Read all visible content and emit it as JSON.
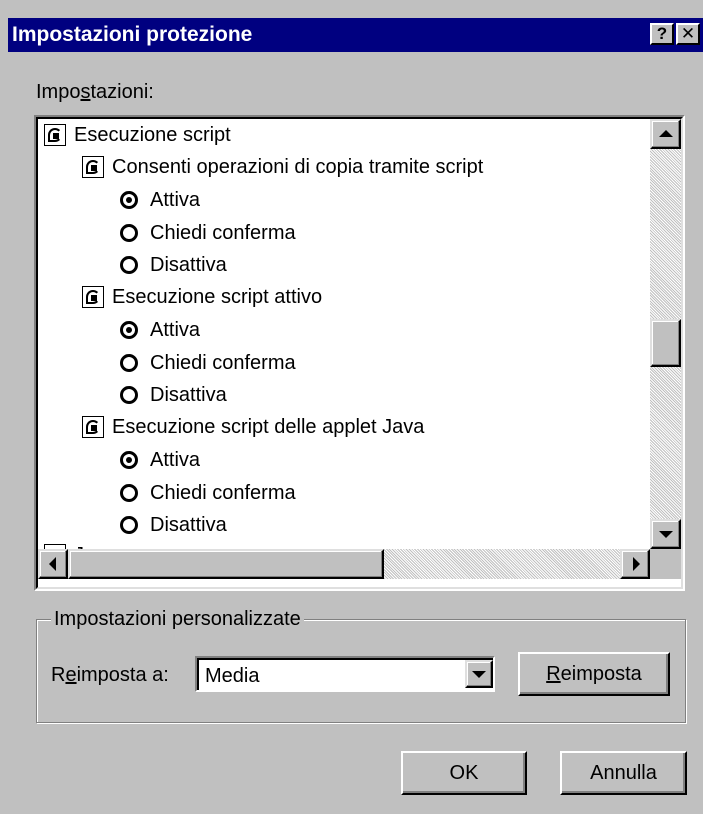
{
  "window": {
    "title": "Impostazioni protezione",
    "help_glyph": "?",
    "close_glyph": "✕"
  },
  "settings_label": {
    "pre": "Impo",
    "mnemonic": "s",
    "post": "tazioni:"
  },
  "tree": {
    "category": "Esecuzione script",
    "groups": [
      {
        "label": "Consenti operazioni di copia tramite script",
        "options": [
          {
            "label": "Attiva",
            "checked": true
          },
          {
            "label": "Chiedi conferma",
            "checked": false
          },
          {
            "label": "Disattiva",
            "checked": false
          }
        ]
      },
      {
        "label": "Esecuzione script attivo",
        "options": [
          {
            "label": "Attiva",
            "checked": true
          },
          {
            "label": "Chiedi conferma",
            "checked": false
          },
          {
            "label": "Disattiva",
            "checked": false
          }
        ]
      },
      {
        "label": "Esecuzione script delle applet Java",
        "options": [
          {
            "label": "Attiva",
            "checked": true
          },
          {
            "label": "Chiedi conferma",
            "checked": false
          },
          {
            "label": "Disattiva",
            "checked": false
          }
        ]
      }
    ],
    "next_category": "Java"
  },
  "custom_settings": {
    "legend": "Impostazioni personalizzate",
    "reset_label": {
      "pre": "R",
      "mnemonic": "e",
      "post": "imposta a:"
    },
    "reset_value": "Media",
    "reset_button": {
      "mnemonic": "R",
      "post": "eimposta"
    }
  },
  "buttons": {
    "ok": "OK",
    "cancel": "Annulla"
  },
  "scroll": {
    "vertical_position": 0.5,
    "horizontal_position": 0.0
  },
  "colors": {
    "titlebar": "#000080",
    "face": "#c0c0c0",
    "window": "#ffffff"
  }
}
